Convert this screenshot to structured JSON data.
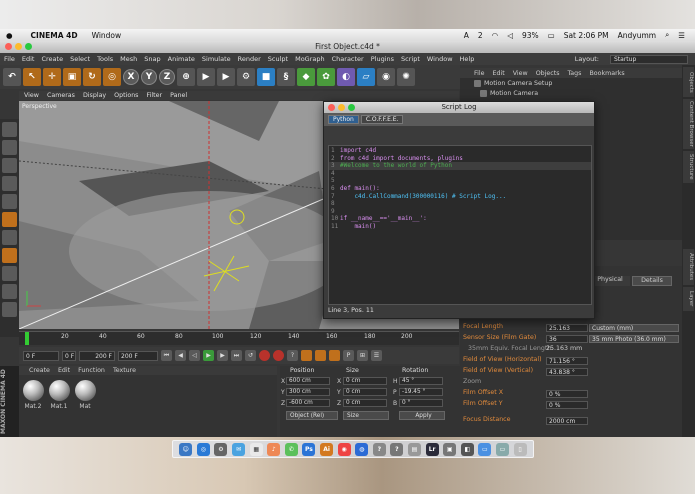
{
  "macmenu": {
    "app": "CINEMA 4D",
    "items": [
      "Window"
    ],
    "status_right": [
      "2",
      "93%",
      "Sat 2:06 PM",
      "Andyumm"
    ]
  },
  "window": {
    "title": "First Object.c4d *"
  },
  "menubar": {
    "items": [
      "File",
      "Edit",
      "Create",
      "Select",
      "Tools",
      "Mesh",
      "Snap",
      "Animate",
      "Simulate",
      "Render",
      "Sculpt",
      "MoGraph",
      "Character",
      "Plugins",
      "Script",
      "Window",
      "Help"
    ],
    "layout_label": "Layout:",
    "layout_value": "Startup"
  },
  "toolbar": {
    "axes": [
      "X",
      "Y",
      "Z"
    ]
  },
  "viewport": {
    "menu": [
      "View",
      "Cameras",
      "Display",
      "Options",
      "Filter",
      "Panel"
    ],
    "label": "Perspective"
  },
  "timeline": {
    "ticks": [
      "0",
      "20",
      "40",
      "60",
      "80",
      "100",
      "120",
      "140",
      "160",
      "180",
      "200"
    ]
  },
  "playbar": {
    "start": "0 F",
    "current": "0 F",
    "end": "200 F",
    "end2": "200 F"
  },
  "materials": {
    "menu": [
      "Create",
      "Edit",
      "Function",
      "Texture"
    ],
    "items": [
      "Mat.2",
      "Mat.1",
      "Mat"
    ]
  },
  "logo": "MAXON CINEMA 4D",
  "coords": {
    "headers": [
      "Position",
      "Size",
      "Rotation"
    ],
    "rows": [
      {
        "axis": "X",
        "pos": "600 cm",
        "size_axis": "X",
        "size": "0 cm",
        "rot_axis": "H",
        "rot": "45 °"
      },
      {
        "axis": "Y",
        "pos": "300 cm",
        "size_axis": "Y",
        "size": "0 cm",
        "rot_axis": "P",
        "rot": "-19.45 °"
      },
      {
        "axis": "Z",
        "pos": "-600 cm",
        "size_axis": "Z",
        "size": "0 cm",
        "rot_axis": "B",
        "rot": "0 °"
      }
    ],
    "mode": "Object (Rel)",
    "size_mode": "Size",
    "apply": "Apply"
  },
  "objmgr": {
    "menu": [
      "File",
      "Edit",
      "View",
      "Objects",
      "Tags",
      "Bookmarks"
    ],
    "items": [
      "Motion Camera Setup",
      "Motion Camera"
    ]
  },
  "attr": {
    "tabs": [
      "Physical",
      "Details"
    ],
    "rows": [
      {
        "label": "Focal Length",
        "value": "25.163",
        "select": "Custom (mm)"
      },
      {
        "label": "Sensor Size (Film Gate)",
        "value": "36",
        "select": "35 mm Photo (36.0 mm)"
      },
      {
        "label": "35mm Equiv. Focal Length:",
        "value": "25.163 mm",
        "select": ""
      },
      {
        "label": "Field of View (Horizontal)",
        "value": "71.156 °",
        "select": ""
      },
      {
        "label": "Field of View (Vertical)",
        "value": "43.838 °",
        "select": ""
      },
      {
        "label": "Zoom",
        "value": "",
        "select": ""
      },
      {
        "label": "Film Offset X",
        "value": "0 %",
        "select": ""
      },
      {
        "label": "Film Offset Y",
        "value": "0 %",
        "select": ""
      },
      {
        "label": "Focus Distance",
        "value": "2000 cm",
        "select": ""
      }
    ]
  },
  "rightstrip": [
    "Objects",
    "Content Browser",
    "Structure",
    "Attributes",
    "Layer"
  ],
  "scriptlog": {
    "title": "Script Log",
    "tabs": [
      "Python",
      "C.O.F.F.E.E."
    ],
    "lines": [
      {
        "n": "1",
        "text": "import c4d"
      },
      {
        "n": "2",
        "text": "from c4d import documents, plugins"
      },
      {
        "n": "3",
        "text": "#Welcome to the world of Python"
      },
      {
        "n": "4",
        "text": ""
      },
      {
        "n": "5",
        "text": ""
      },
      {
        "n": "6",
        "text": "def main():"
      },
      {
        "n": "7",
        "text": "    c4d.CallCommand(300000116) # Script Log..."
      },
      {
        "n": "8",
        "text": ""
      },
      {
        "n": "9",
        "text": ""
      },
      {
        "n": "10",
        "text": "if __name__=='__main__':"
      },
      {
        "n": "11",
        "text": "    main()"
      }
    ],
    "status": "Line 3, Pos. 11"
  },
  "dock": [
    "Ps",
    "Ai",
    "Lr"
  ]
}
